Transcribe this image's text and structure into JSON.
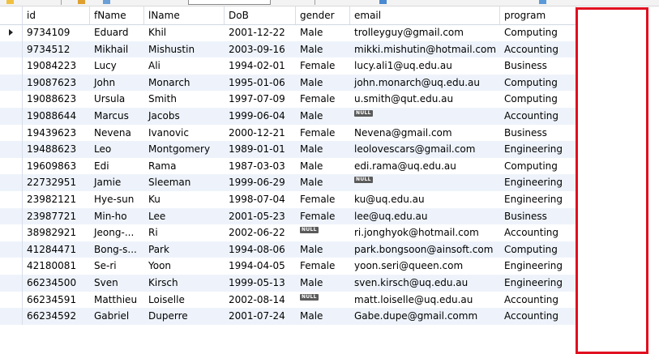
{
  "toolbar": {
    "icons": [
      "lightning-icon",
      "refresh-icon",
      "filter-rows-box",
      "grid-view-icon",
      "export-icon",
      "wrap-icon"
    ]
  },
  "grid": {
    "columns": [
      {
        "key": "id",
        "label": "id"
      },
      {
        "key": "fName",
        "label": "fName"
      },
      {
        "key": "lName",
        "label": "lName"
      },
      {
        "key": "DoB",
        "label": "DoB"
      },
      {
        "key": "gender",
        "label": "gender"
      },
      {
        "key": "email",
        "label": "email"
      },
      {
        "key": "program",
        "label": "program"
      }
    ],
    "null_label": "NULL",
    "selected_row": 0,
    "rows": [
      {
        "id": "9734109",
        "fName": "Eduard",
        "lName": "Khil",
        "DoB": "2001-12-22",
        "gender": "Male",
        "email": "trolleyguy@gmail.com",
        "program": "Computing"
      },
      {
        "id": "9734512",
        "fName": "Mikhail",
        "lName": "Mishustin",
        "DoB": "2003-09-16",
        "gender": "Male",
        "email": "mikki.mishutin@hotmail.com",
        "program": "Accounting"
      },
      {
        "id": "19084223",
        "fName": "Lucy",
        "lName": "Ali",
        "DoB": "1994-02-01",
        "gender": "Female",
        "email": "lucy.ali1@uq.edu.au",
        "program": "Business"
      },
      {
        "id": "19087623",
        "fName": "John",
        "lName": "Monarch",
        "DoB": "1995-01-06",
        "gender": "Male",
        "email": "john.monarch@uq.edu.au",
        "program": "Computing"
      },
      {
        "id": "19088623",
        "fName": "Ursula",
        "lName": "Smith",
        "DoB": "1997-07-09",
        "gender": "Female",
        "email": "u.smith@qut.edu.au",
        "program": "Computing"
      },
      {
        "id": "19088644",
        "fName": "Marcus",
        "lName": "Jacobs",
        "DoB": "1999-06-04",
        "gender": "Male",
        "email": null,
        "program": "Accounting"
      },
      {
        "id": "19439623",
        "fName": "Nevena",
        "lName": "Ivanovic",
        "DoB": "2000-12-21",
        "gender": "Female",
        "email": "Nevena@gmail.com",
        "program": "Business"
      },
      {
        "id": "19488623",
        "fName": "Leo",
        "lName": "Montgomery",
        "DoB": "1989-01-01",
        "gender": "Male",
        "email": "leolovescars@gmail.com",
        "program": "Engineering"
      },
      {
        "id": "19609863",
        "fName": "Edi",
        "lName": "Rama",
        "DoB": "1987-03-03",
        "gender": "Male",
        "email": "edi.rama@uq.edu.au",
        "program": "Computing"
      },
      {
        "id": "22732951",
        "fName": "Jamie",
        "lName": "Sleeman",
        "DoB": "1999-06-29",
        "gender": "Male",
        "email": null,
        "program": "Engineering"
      },
      {
        "id": "23982121",
        "fName": "Hye-sun",
        "lName": "Ku",
        "DoB": "1998-07-04",
        "gender": "Female",
        "email": "ku@uq.edu.au",
        "program": "Engineering"
      },
      {
        "id": "23987721",
        "fName": "Min-ho",
        "lName": "Lee",
        "DoB": "2001-05-23",
        "gender": "Female",
        "email": "lee@uq.edu.au",
        "program": "Business"
      },
      {
        "id": "38982921",
        "fName": "Jeong-...",
        "lName": "Ri",
        "DoB": "2002-06-22",
        "gender": null,
        "email": "ri.jonghyok@hotmail.com",
        "program": "Accounting"
      },
      {
        "id": "41284471",
        "fName": "Bong-s...",
        "lName": "Park",
        "DoB": "1994-08-06",
        "gender": "Male",
        "email": "park.bongsoon@ainsoft.com",
        "program": "Computing"
      },
      {
        "id": "42180081",
        "fName": "Se-ri",
        "lName": "Yoon",
        "DoB": "1994-04-05",
        "gender": "Female",
        "email": "yoon.seri@queen.com",
        "program": "Engineering"
      },
      {
        "id": "66234500",
        "fName": "Sven",
        "lName": "Kirsch",
        "DoB": "1999-05-13",
        "gender": "Male",
        "email": "sven.kirsch@uq.edu.au",
        "program": "Engineering"
      },
      {
        "id": "66234591",
        "fName": "Matthieu",
        "lName": "Loiselle",
        "DoB": "2002-08-14",
        "gender": null,
        "email": "matt.loiselle@uq.edu.au",
        "program": "Accounting"
      },
      {
        "id": "66234592",
        "fName": "Gabriel",
        "lName": "Duperre",
        "DoB": "2001-07-24",
        "gender": "Male",
        "email": "Gabe.dupe@gmail.comm",
        "program": "Accounting"
      }
    ]
  },
  "highlight": {
    "color": "#e01020"
  },
  "colors": {
    "alt_row": "#eef3fb",
    "grid_line": "#d7dee9",
    "null_badge": "#5a5a5a"
  }
}
